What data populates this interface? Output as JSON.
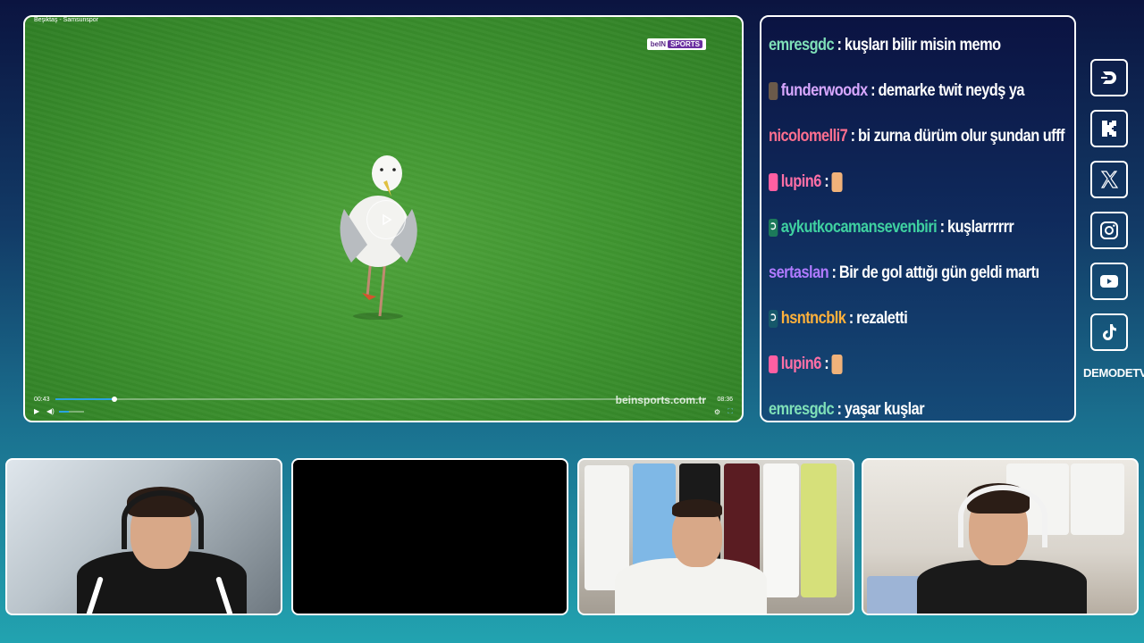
{
  "video": {
    "title": "Beşiktaş - Samsunspor",
    "broadcaster_logo_a": "beIN",
    "broadcaster_logo_b": "SPORTS",
    "watermark": "beinsports.com.tr",
    "current_time": "00:43",
    "total_time": "08:36",
    "progress_fraction": 0.09,
    "volume_fraction": 0.4
  },
  "chat": {
    "messages": [
      {
        "user": "emresgdc",
        "color": "#7fe0b8",
        "badge": "",
        "text": "kuşları bilir misin memo"
      },
      {
        "user": "funderwoodx",
        "color": "#d7a7ff",
        "badge": "avatar",
        "text": "demarke twit neydş ya"
      },
      {
        "user": "nicolomelli7",
        "color": "#ff6f8f",
        "badge": "",
        "text": "bi zurna dürüm olur şundan ufff"
      },
      {
        "user": "lupin6",
        "color": "#ff6fa6",
        "badge": "pink",
        "text": "",
        "emote": true
      },
      {
        "user": "aykutkocamansevenbiri",
        "color": "#3fd1a0",
        "badge": "green",
        "text": "kuşlarrrrrr"
      },
      {
        "user": "sertaslan",
        "color": "#b07aff",
        "badge": "",
        "text": "Bir de gol attığı gün geldi martı"
      },
      {
        "user": "hsntncblk",
        "color": "#ffb13b",
        "badge": "teal",
        "text": "rezaletti"
      },
      {
        "user": "lupin6",
        "color": "#ff6fa6",
        "badge": "pink",
        "text": "",
        "emote": true
      },
      {
        "user": "emresgdc",
        "color": "#7fe0b8",
        "badge": "",
        "text": "yaşar kuşlar"
      }
    ]
  },
  "social": {
    "icons": [
      "dlive-icon",
      "kick-icon",
      "x-icon",
      "instagram-icon",
      "youtube-icon",
      "tiktok-icon"
    ],
    "brand": "DEMODETV"
  }
}
